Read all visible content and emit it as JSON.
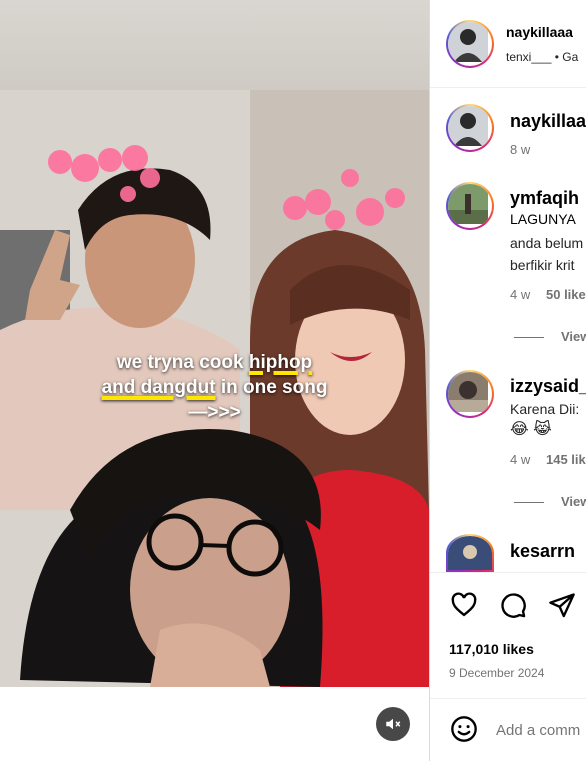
{
  "video": {
    "caption_line1_pre": "we tryna cook ",
    "caption_line1_hl": "hiphop",
    "caption_line2_hl": "and dangdut",
    "caption_line2_post": " in one song",
    "caption_line3": "—>>>",
    "mute_icon": "speaker-muted-icon",
    "highlight_color": "#ffe600"
  },
  "post": {
    "header": {
      "username": "naykillaaa",
      "audio_user": "tenxi___",
      "audio_separator": "•",
      "audio_track": "Ga"
    },
    "caption_author": {
      "username": "naykillaaa",
      "time": "8 w"
    },
    "comments": [
      {
        "username": "ymfaqih",
        "lines": [
          "LAGUNYA",
          "anda belum",
          "berfikir krit"
        ],
        "time": "4 w",
        "likes": "50 like",
        "view_replies": "View"
      },
      {
        "username": "izzysaid_",
        "lines": [
          "Karena Dii:",
          "😂 😹"
        ],
        "time": "4 w",
        "likes": "145 lik",
        "view_replies": "View"
      },
      {
        "username": "kesarrn"
      }
    ],
    "likes_count": "117,010 likes",
    "date": "9 December 2024",
    "add_comment_placeholder": "Add a comm"
  }
}
